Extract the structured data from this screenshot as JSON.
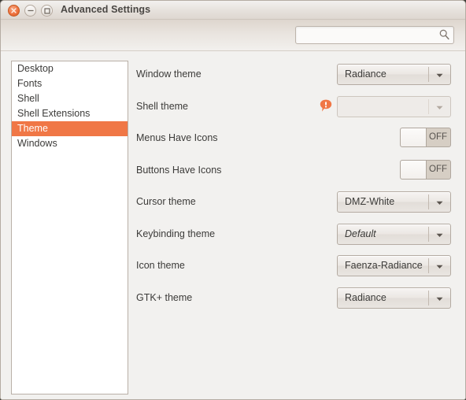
{
  "window": {
    "title": "Advanced Settings",
    "controls": {
      "close": "close-button",
      "minimize": "minimize-button",
      "maximize": "maximize-button"
    }
  },
  "toolbar": {
    "search": {
      "value": "",
      "placeholder": "",
      "icon": "search-icon"
    }
  },
  "sidebar": {
    "items": [
      {
        "label": "Desktop",
        "selected": false
      },
      {
        "label": "Fonts",
        "selected": false
      },
      {
        "label": "Shell",
        "selected": false
      },
      {
        "label": "Shell Extensions",
        "selected": false
      },
      {
        "label": "Theme",
        "selected": true
      },
      {
        "label": "Windows",
        "selected": false
      }
    ],
    "selected_color": "#f07746"
  },
  "settings": {
    "rows": [
      {
        "label": "Window theme",
        "type": "combo",
        "value": "Radiance",
        "italic": false,
        "disabled": false,
        "warning": false
      },
      {
        "label": "Shell theme",
        "type": "combo",
        "value": "",
        "italic": false,
        "disabled": true,
        "warning": true
      },
      {
        "label": "Menus Have Icons",
        "type": "switch",
        "value": "OFF",
        "state": "off"
      },
      {
        "label": "Buttons Have Icons",
        "type": "switch",
        "value": "OFF",
        "state": "off"
      },
      {
        "label": "Cursor theme",
        "type": "combo",
        "value": "DMZ-White",
        "italic": false,
        "disabled": false,
        "warning": false
      },
      {
        "label": "Keybinding theme",
        "type": "combo",
        "value": "Default",
        "italic": true,
        "disabled": false,
        "warning": false
      },
      {
        "label": "Icon theme",
        "type": "combo",
        "value": "Faenza-Radiance",
        "italic": false,
        "disabled": false,
        "warning": false
      },
      {
        "label": "GTK+ theme",
        "type": "combo",
        "value": "Radiance",
        "italic": false,
        "disabled": false,
        "warning": false
      }
    ],
    "warning_icon": "warning-exclamation-icon",
    "warning_color": "#f07746"
  }
}
